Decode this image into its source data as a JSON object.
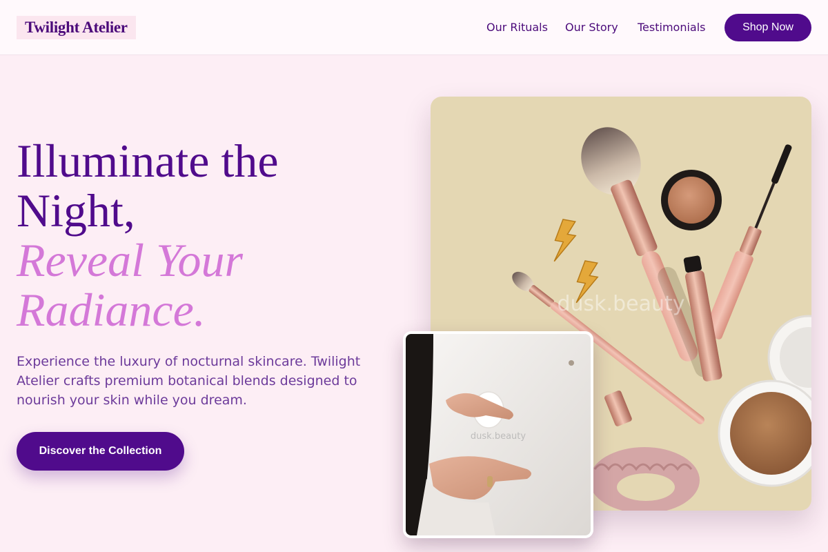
{
  "brand": {
    "name": "Twilight Atelier"
  },
  "nav": {
    "items": [
      {
        "label": "Our Rituals"
      },
      {
        "label": "Our Story"
      },
      {
        "label": "Testimonials"
      }
    ],
    "cta_label": "Shop Now"
  },
  "hero": {
    "headline_line1": "Illuminate the",
    "headline_line2": "Night,",
    "headline_accent_line1": "Reveal Your",
    "headline_accent_line2": "Radiance.",
    "description": "Experience the luxury of nocturnal skincare. Twilight Atelier crafts premium botanical blends designed to nourish your skin while you dream.",
    "cta_label": "Discover the Collection"
  },
  "images": {
    "product_watermark": "dusk.beauty",
    "hands_watermark": "dusk.beauty"
  },
  "colors": {
    "page_background": "#fdeef5",
    "primary": "#500b8c",
    "accent": "#d478d8",
    "body_text": "#6c3a9a"
  }
}
